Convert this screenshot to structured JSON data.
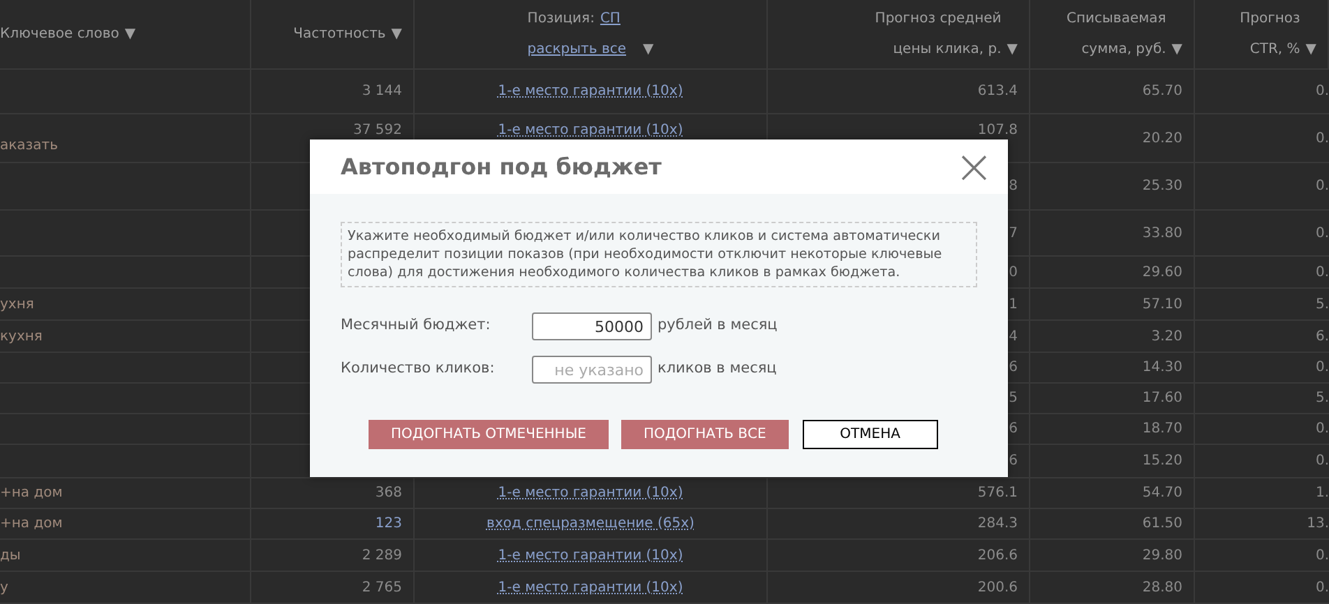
{
  "table": {
    "columns": [
      {
        "lines": [
          "Ключевое слово"
        ],
        "sort": "▼"
      },
      {
        "lines": [
          "Частотность"
        ],
        "sort": "▼"
      },
      {
        "kind": "position",
        "label": "Позиция:",
        "link": "СП",
        "expand_link": "раскрыть все",
        "sort": "▼"
      },
      {
        "lines": [
          "Прогноз средней",
          "цены клика, р."
        ],
        "sort": "▼"
      },
      {
        "lines": [
          "Списываемая",
          "сумма, руб."
        ],
        "sort": "▼"
      },
      {
        "lines": [
          "Прогноз",
          "CTR, %"
        ],
        "sort": "▼"
      }
    ],
    "rows": [
      {
        "frequency": "3 144",
        "frequency_highlighted": false,
        "position": "1-е место гарантии (10х)",
        "price": "613.4",
        "spend": "65.70",
        "ctr": "0."
      },
      {
        "keyword": "аказать",
        "frequency": "37 592",
        "frequency_highlighted": false,
        "position": "1-е место гарантии (10х)",
        "price": "107.8",
        "spend": "20.20",
        "ctr": "0."
      },
      {
        "price": "8",
        "spend": "25.30",
        "ctr": "0."
      },
      {
        "price": "7",
        "spend": "33.80",
        "ctr": "0."
      },
      {
        "price": "0",
        "spend": "29.60",
        "ctr": "0."
      },
      {
        "keyword": "ухня",
        "price": "1",
        "spend": "57.10",
        "ctr": "5."
      },
      {
        "keyword": "кухня",
        "price": "4",
        "spend": "3.20",
        "ctr": "6."
      },
      {
        "price": "6",
        "spend": "14.30",
        "ctr": "0."
      },
      {
        "price": "5",
        "spend": "17.60",
        "ctr": "5."
      },
      {
        "price": "6",
        "spend": "18.70",
        "ctr": "0."
      },
      {
        "price": "6",
        "spend": "15.20",
        "ctr": "0."
      },
      {
        "keyword": "+на дом",
        "frequency": "368",
        "frequency_highlighted": false,
        "position": "1-е место гарантии (10х)",
        "price": "576.1",
        "spend": "54.70",
        "ctr": "1."
      },
      {
        "keyword": "+на дом",
        "frequency": "123",
        "frequency_highlighted": true,
        "position": "вход спецразмещение (65х)",
        "price": "284.3",
        "spend": "61.50",
        "ctr": "13."
      },
      {
        "keyword": "ды",
        "frequency": "2 289",
        "frequency_highlighted": false,
        "position": "1-е место гарантии (10х)",
        "price": "206.6",
        "spend": "29.80",
        "ctr": "0."
      },
      {
        "keyword": "у",
        "frequency": "2 765",
        "frequency_highlighted": false,
        "position": "1-е место гарантии (10х)",
        "price": "200.6",
        "spend": "28.80",
        "ctr": "0."
      }
    ]
  },
  "dialog": {
    "title": "Автоподгон под бюджет",
    "close": "×",
    "info": "Укажите необходимый бюджет и/или количество кликов и система автоматически распределит позиции показов (при необходимости отключит некоторые ключевые слова) для достижения необходимого количества кликов в рамках бюджета.",
    "fields": [
      {
        "label": "Месячный бюджет:",
        "value": "50000",
        "suffix": "рублей в месяц"
      },
      {
        "label": "Количество кликов:",
        "placeholder": "не указано",
        "suffix": "кликов в месяц"
      }
    ],
    "buttons": [
      {
        "label": "ПОДОГНАТЬ ОТМЕЧЕННЫЕ",
        "kind": "primary"
      },
      {
        "label": "ПОДОГНАТЬ ВСЕ",
        "kind": "primary"
      },
      {
        "label": "ОТМЕНА",
        "kind": "secondary"
      }
    ]
  }
}
